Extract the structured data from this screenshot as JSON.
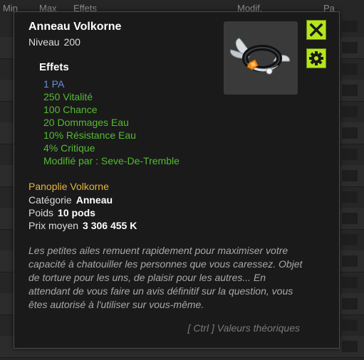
{
  "background_table": {
    "headers": [
      "Min",
      "Max",
      "Effets",
      "Modif.",
      "Pa"
    ]
  },
  "tooltip": {
    "item_name": "Anneau Volkorne",
    "level_label": "Niveau",
    "level_value": "200",
    "effects_title": "Effets",
    "effects": [
      "1 PA",
      "250 Vitalité",
      "100 Chance",
      "20 Dommages Eau",
      "10% Résistance Eau",
      "4% Critique",
      "Modifié par : Seve-De-Tremble"
    ],
    "panoplie": "Panoplie Volkorne",
    "category_label": "Catégorie",
    "category_value": "Anneau",
    "weight_label": "Poids",
    "weight_value": "10 pods",
    "price_label": "Prix moyen",
    "price_value": "3 306 455 K",
    "description": "Les petites ailes remuent rapidement pour maximiser votre capacité à chatouiller les personnes que vous caressez. Objet de torture pour les uns, de plaisir pour les autres... En attendant de vous faire un avis définitif sur la question, vous êtes autorisé à l'utiliser sur vous-même.",
    "ctrl_hint": "[ Ctrl ] Valeurs théoriques",
    "close_icon": "close-icon",
    "gear_icon": "gear-icon"
  },
  "colors": {
    "effect_green": "#56b934",
    "pa_blue": "#6b8ed8",
    "panoplie_gold": "#e6b43c",
    "button_lime": "#b5e61d"
  }
}
